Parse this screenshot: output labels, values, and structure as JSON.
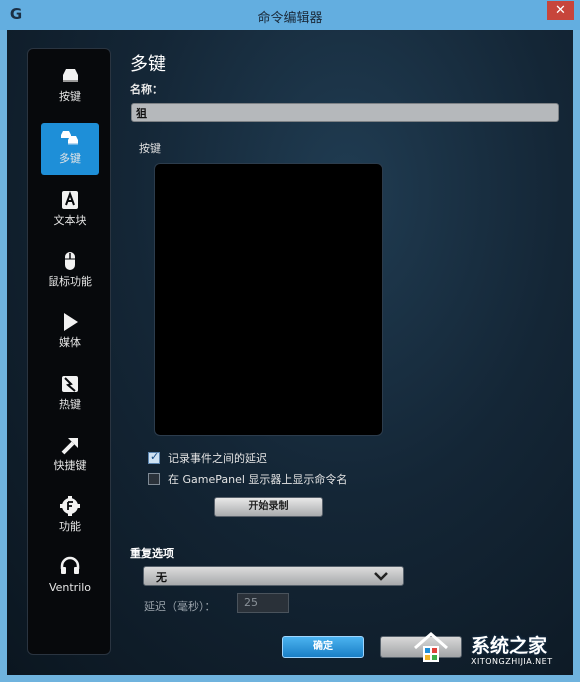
{
  "window": {
    "title": "命令编辑器",
    "logo": "G",
    "close": "✕"
  },
  "sidebar": {
    "items": [
      {
        "label": "按键",
        "icon": "key-icon"
      },
      {
        "label": "多键",
        "icon": "multikey-icon",
        "active": true
      },
      {
        "label": "文本块",
        "icon": "text-block-icon"
      },
      {
        "label": "鼠标功能",
        "icon": "mouse-icon"
      },
      {
        "label": "媒体",
        "icon": "play-icon"
      },
      {
        "label": "热键",
        "icon": "hotkey-icon"
      },
      {
        "label": "快捷键",
        "icon": "shortcut-arrow-icon"
      },
      {
        "label": "功能",
        "icon": "function-gear-icon"
      },
      {
        "label": "Ventrilo",
        "icon": "headset-icon"
      }
    ]
  },
  "main": {
    "title": "多键",
    "name_label": "名称：",
    "name_value": "狙",
    "keys_label": "按键",
    "record_delays_label": "记录事件之间的延迟",
    "record_delays_checked": true,
    "show_name_label": "在 GamePanel 显示器上显示命令名",
    "show_name_checked": false,
    "start_record_button": "开始录制",
    "repeat_label": "重复选项",
    "repeat_value": "无",
    "delay_label": "延迟（毫秒）：",
    "delay_value": "25",
    "ok_button": "确定"
  },
  "watermark": {
    "text": "系统之家",
    "sub": "XITONGZHIJIA.NET"
  }
}
